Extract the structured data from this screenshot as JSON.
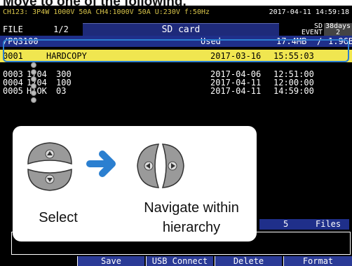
{
  "heading": "Move to one of the following.",
  "status": {
    "channel_info": "CH123: 3P4W  1000V  50A   CH4:1000V  50A  U:230V f:50Hz",
    "datetime": "2017-04-11 14:59:18"
  },
  "mode": {
    "file_label": "FILE",
    "page": "1/2",
    "title": "SD card",
    "device": "SD",
    "event_label": "EVENT",
    "days": "38days",
    "event_count": "2"
  },
  "path": {
    "folder": "/PQ3100",
    "used_label": "Used",
    "used_value": "17.4MB",
    "separator": "/",
    "capacity": "1.9GB"
  },
  "rows": [
    {
      "index": "0001",
      "name": "HARDCOPY",
      "date": "2017-03-16",
      "time": "15:55:03"
    },
    {
      "index": "0003",
      "name": "1704",
      "name_tail": "300",
      "date": "2017-04-06",
      "time": "12:51:00"
    },
    {
      "index": "0004",
      "name": "1704",
      "name_tail": "100",
      "date": "2017-04-11",
      "time": "12:00:00"
    },
    {
      "index": "0005",
      "name": "HIOK",
      "name_tail": "03",
      "date": "2017-04-11",
      "time": "14:59:00"
    }
  ],
  "files": {
    "count": "5",
    "label": "Files"
  },
  "softkeys": [
    "Save",
    "USB Connect",
    "Delete",
    "Format"
  ],
  "guide": {
    "select_label": "Select",
    "navigate_label_line1": "Navigate within",
    "navigate_label_line2": "hierarchy",
    "accent_color": "#2b7fd0"
  }
}
